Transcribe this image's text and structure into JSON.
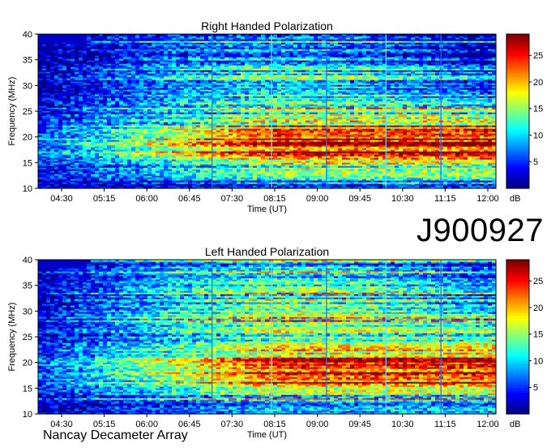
{
  "observation_id": "J900927",
  "footer": "Nancay Decameter Array",
  "colors": {
    "palette": "jet",
    "background": "#00008f"
  },
  "chart_data": [
    {
      "type": "heatmap",
      "title": "Right Handed Polarization",
      "xlabel": "Time (UT)",
      "ylabel": "Frequency (MHz)",
      "x_ticks": [
        "04:30",
        "05:15",
        "06:00",
        "06:45",
        "07:30",
        "08:15",
        "09:00",
        "09:45",
        "10:30",
        "11:15",
        "12:00"
      ],
      "y_ticks": [
        10,
        15,
        20,
        25,
        30,
        35,
        40
      ],
      "ylim": [
        10,
        40
      ],
      "colorbar": {
        "label": "dB",
        "ticks": [
          5,
          10,
          15,
          20,
          25
        ],
        "range": [
          0,
          29
        ]
      },
      "emission_profile": [
        {
          "freq": 11,
          "db": 6
        },
        {
          "freq": 13,
          "db": 12
        },
        {
          "freq": 15,
          "db": 16
        },
        {
          "freq": 17,
          "db": 22
        },
        {
          "freq": 19,
          "db": 26
        },
        {
          "freq": 21,
          "db": 24
        },
        {
          "freq": 23,
          "db": 16
        },
        {
          "freq": 25,
          "db": 12
        },
        {
          "freq": 27,
          "db": 10
        },
        {
          "freq": 29,
          "db": 7
        },
        {
          "freq": 32,
          "db": 5
        },
        {
          "freq": 36,
          "db": 3
        },
        {
          "freq": 39,
          "db": 2
        }
      ]
    },
    {
      "type": "heatmap",
      "title": "Left Handed Polarization",
      "xlabel": "Time (UT)",
      "ylabel": "Frequency (MHz)",
      "x_ticks": [
        "04:30",
        "05:15",
        "06:00",
        "06:45",
        "07:30",
        "08:15",
        "09:00",
        "09:45",
        "10:30",
        "11:15",
        "12:00"
      ],
      "y_ticks": [
        10,
        15,
        20,
        25,
        30,
        35,
        40
      ],
      "ylim": [
        10,
        40
      ],
      "colorbar": {
        "label": "dB",
        "ticks": [
          5,
          10,
          15,
          20,
          25
        ],
        "range": [
          0,
          29
        ]
      },
      "emission_profile": [
        {
          "freq": 11,
          "db": 6
        },
        {
          "freq": 13,
          "db": 12
        },
        {
          "freq": 15,
          "db": 15
        },
        {
          "freq": 17,
          "db": 21
        },
        {
          "freq": 19,
          "db": 25
        },
        {
          "freq": 21,
          "db": 23
        },
        {
          "freq": 23,
          "db": 16
        },
        {
          "freq": 25,
          "db": 13
        },
        {
          "freq": 27,
          "db": 11
        },
        {
          "freq": 29,
          "db": 8
        },
        {
          "freq": 32,
          "db": 6
        },
        {
          "freq": 36,
          "db": 4
        },
        {
          "freq": 39,
          "db": 3
        }
      ]
    }
  ]
}
